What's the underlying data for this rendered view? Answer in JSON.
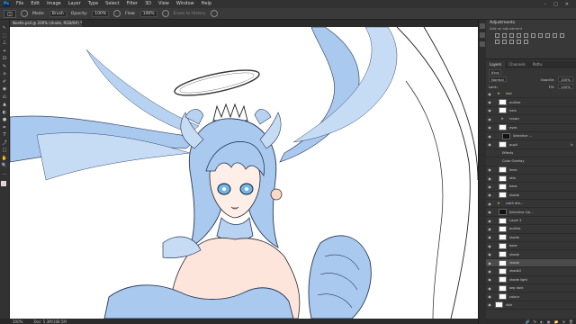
{
  "app": {
    "logo": "Ps"
  },
  "menu": [
    "File",
    "Edit",
    "Image",
    "Layer",
    "Type",
    "Select",
    "Filter",
    "3D",
    "View",
    "Window",
    "Help"
  ],
  "window_controls": [
    "–",
    "□",
    "✕"
  ],
  "options": {
    "mode_label": "Mode:",
    "mode_value": "Brush",
    "opacity_label": "Opacity:",
    "opacity_value": "100%",
    "flow_label": "Flow:",
    "flow_value": "100%",
    "erase_label": "Erase to History"
  },
  "document_tab": {
    "label": "Noelle.psd @ 200% (shade, RGB/8#) *"
  },
  "tools": [
    "↖",
    "⬚",
    "ℒ",
    "⌖",
    "⊡",
    "✎",
    "⌂",
    "✐",
    "◉",
    "⎌",
    "▲",
    "◐",
    "●",
    "✒",
    "T",
    "⤴",
    "□",
    "✋",
    "🔍",
    "…"
  ],
  "colors": {
    "foreground": "#f2c9d6",
    "background": "#ffffff",
    "accent": "#31a8ff"
  },
  "status": {
    "zoom": "200%",
    "doc": "Doc: 5.3M/168.5M"
  },
  "adjustments": {
    "title": "Adjustments",
    "subtitle": "Add an adjustment"
  },
  "layers_panel": {
    "tabs": [
      "Layers",
      "Channels",
      "Paths"
    ],
    "filter_label": "Kind",
    "blend_mode": "Normal",
    "opacity_label": "Opacity:",
    "opacity_value": "100%",
    "lock_label": "Lock:",
    "fill_label": "Fill:",
    "fill_value": "100%",
    "layers": [
      {
        "name": "hair",
        "type": "folder",
        "indent": 0
      },
      {
        "name": "outline",
        "type": "layer",
        "indent": 1
      },
      {
        "name": "halo",
        "type": "layer",
        "indent": 1
      },
      {
        "name": "crown",
        "type": "folder",
        "indent": 1
      },
      {
        "name": "eyes",
        "type": "layer",
        "indent": 1
      },
      {
        "name": "Selective ...",
        "type": "adjust",
        "indent": 2
      },
      {
        "name": "pupil",
        "type": "layer",
        "indent": 1,
        "fx": "fx"
      },
      {
        "name": "Effects",
        "type": "effect",
        "indent": 2
      },
      {
        "name": "Color Overlay",
        "type": "effect",
        "indent": 2
      },
      {
        "name": "lines",
        "type": "layer",
        "indent": 1
      },
      {
        "name": "skin",
        "type": "layer",
        "indent": 1
      },
      {
        "name": "base",
        "type": "layer",
        "indent": 1
      },
      {
        "name": "shade",
        "type": "layer",
        "indent": 1
      },
      {
        "name": "cloth dre...",
        "type": "folder",
        "indent": 0
      },
      {
        "name": "Selective Col...",
        "type": "adjust",
        "indent": 1
      },
      {
        "name": "Layer 3",
        "type": "layer",
        "indent": 1
      },
      {
        "name": "outline",
        "type": "layer",
        "indent": 1
      },
      {
        "name": "shade",
        "type": "layer",
        "indent": 1
      },
      {
        "name": "base",
        "type": "layer",
        "indent": 1
      },
      {
        "name": "shade",
        "type": "layer",
        "indent": 1
      },
      {
        "name": "shade",
        "type": "layer",
        "indent": 1,
        "selected": true
      },
      {
        "name": "shade2",
        "type": "layer",
        "indent": 1
      },
      {
        "name": "shade light",
        "type": "layer",
        "indent": 1
      },
      {
        "name": "sep dark",
        "type": "layer",
        "indent": 1
      },
      {
        "name": "colour",
        "type": "layer",
        "indent": 1
      },
      {
        "name": "skin",
        "type": "layer",
        "indent": 0
      }
    ]
  },
  "footer_icons": [
    "🔗",
    "fx",
    "◐",
    "▣",
    "📁",
    "⊞",
    "🗑"
  ]
}
